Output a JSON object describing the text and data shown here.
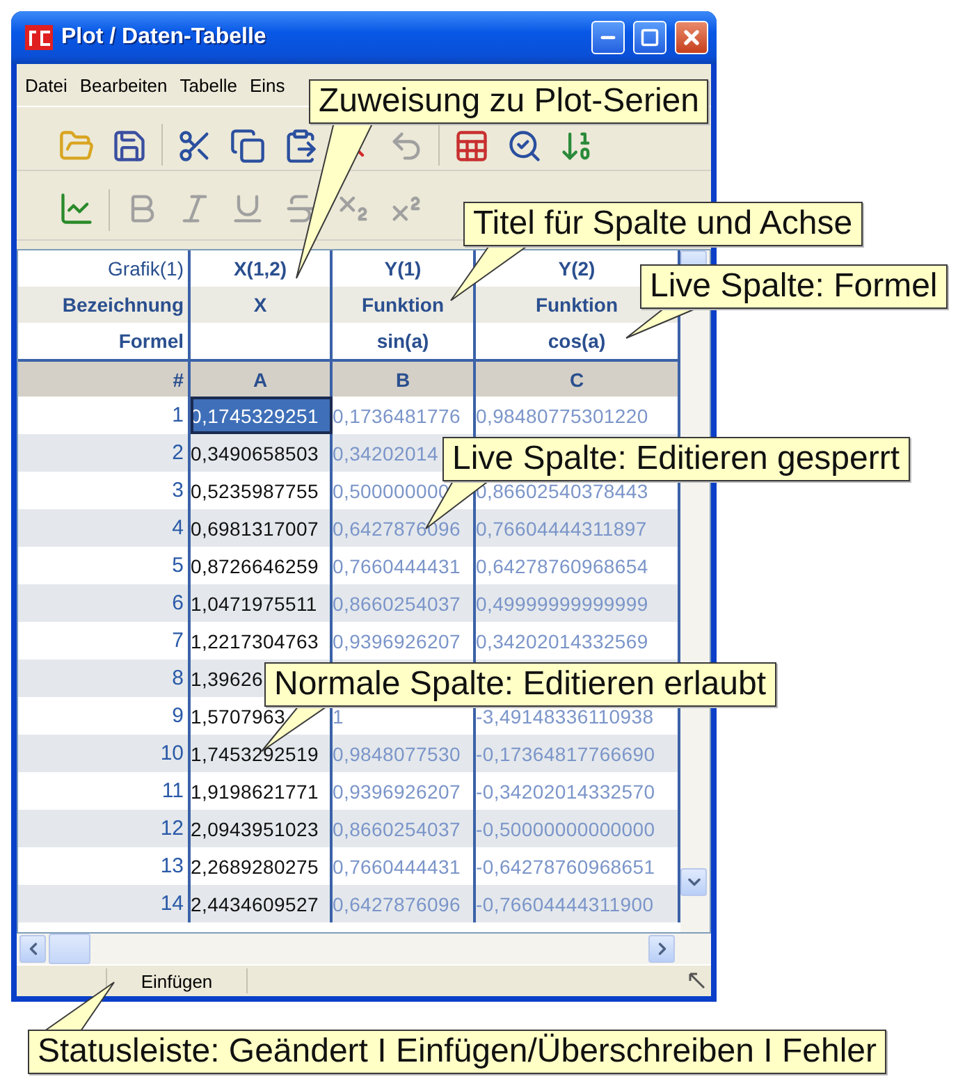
{
  "window": {
    "title": "Plot / Daten-Tabelle"
  },
  "menu": [
    "Datei",
    "Bearbeiten",
    "Tabelle",
    "Eins"
  ],
  "toolbar_1": [
    {
      "kind": "open",
      "disabled": false
    },
    {
      "kind": "save",
      "disabled": false
    },
    {
      "kind": "sep"
    },
    {
      "kind": "cut",
      "disabled": false
    },
    {
      "kind": "copy",
      "disabled": false
    },
    {
      "kind": "paste",
      "disabled": false
    },
    {
      "kind": "delete",
      "disabled": false
    },
    {
      "kind": "undo",
      "disabled": true
    },
    {
      "kind": "sep"
    },
    {
      "kind": "clear",
      "disabled": false
    },
    {
      "kind": "find",
      "disabled": false
    },
    {
      "kind": "sort",
      "disabled": false
    }
  ],
  "toolbar_2": [
    {
      "kind": "add-chart",
      "disabled": false
    },
    {
      "kind": "sep"
    },
    {
      "kind": "bold",
      "disabled": true
    },
    {
      "kind": "italic",
      "disabled": true
    },
    {
      "kind": "underline",
      "disabled": true
    },
    {
      "kind": "strike",
      "disabled": true
    },
    {
      "kind": "subscript",
      "disabled": true
    },
    {
      "kind": "superscript",
      "disabled": true
    }
  ],
  "row_labels": {
    "grafik": "Grafik(1)",
    "bezeichnung": "Bezeichnung",
    "formel": "Formel",
    "number": "#"
  },
  "columns": [
    {
      "letter": "A",
      "grafik": "X(1,2)",
      "bezeichnung": "X",
      "kind": "normal"
    },
    {
      "letter": "B",
      "grafik": "Y(1)",
      "bezeichnung": "Funktion",
      "formel": "sin(a)",
      "kind": "live"
    },
    {
      "letter": "C",
      "grafik": "Y(2)",
      "bezeichnung": "Funktion",
      "formel": "cos(a)",
      "kind": "live"
    }
  ],
  "rows": [
    {
      "number": "1",
      "cells": [
        {
          "text": "0,1745329251",
          "selected": true
        },
        {
          "text": "0,1736481776",
          "selected": false
        },
        {
          "text": "0,98480775301220",
          "selected": false
        }
      ]
    },
    {
      "number": "2",
      "cells": [
        {
          "text": "0,3490658503",
          "selected": false
        },
        {
          "text": "0,34202014",
          "selected": false
        },
        null
      ]
    },
    {
      "number": "3",
      "cells": [
        {
          "text": "0,5235987755",
          "selected": false
        },
        {
          "text": "0,500000000",
          "selected": false
        },
        {
          "text": "0,86602540378443",
          "selected": false
        }
      ]
    },
    {
      "number": "4",
      "cells": [
        {
          "text": "0,6981317007",
          "selected": false
        },
        {
          "text": "0,6427876096",
          "selected": false
        },
        {
          "text": "0,76604444311897",
          "selected": false
        }
      ]
    },
    {
      "number": "5",
      "cells": [
        {
          "text": "0,8726646259",
          "selected": false
        },
        {
          "text": "0,7660444431",
          "selected": false
        },
        {
          "text": "0,64278760968654",
          "selected": false
        }
      ]
    },
    {
      "number": "6",
      "cells": [
        {
          "text": "1,0471975511",
          "selected": false
        },
        {
          "text": "0,8660254037",
          "selected": false
        },
        {
          "text": "0,49999999999999",
          "selected": false
        }
      ]
    },
    {
      "number": "7",
      "cells": [
        {
          "text": "1,2217304763",
          "selected": false
        },
        {
          "text": "0,9396926207",
          "selected": false
        },
        {
          "text": "0,34202014332569",
          "selected": false
        }
      ]
    },
    {
      "number": "8",
      "cells": [
        {
          "text": "1,39626",
          "selected": false
        },
        null,
        null
      ]
    },
    {
      "number": "9",
      "cells": [
        {
          "text": "1,5707963",
          "selected": false
        },
        {
          "text": "1",
          "selected": false
        },
        {
          "text": "-3,49148336110938",
          "selected": false
        }
      ]
    },
    {
      "number": "10",
      "cells": [
        {
          "text": "1,7453292519",
          "selected": false
        },
        {
          "text": "0,9848077530",
          "selected": false
        },
        {
          "text": "-0,17364817766690",
          "selected": false
        }
      ]
    },
    {
      "number": "11",
      "cells": [
        {
          "text": "1,9198621771",
          "selected": false
        },
        {
          "text": "0,9396926207",
          "selected": false
        },
        {
          "text": "-0,34202014332570",
          "selected": false
        }
      ]
    },
    {
      "number": "12",
      "cells": [
        {
          "text": "2,0943951023",
          "selected": false
        },
        {
          "text": "0,8660254037",
          "selected": false
        },
        {
          "text": "-0,50000000000000",
          "selected": false
        }
      ]
    },
    {
      "number": "13",
      "cells": [
        {
          "text": "2,2689280275",
          "selected": false
        },
        {
          "text": "0,7660444431",
          "selected": false
        },
        {
          "text": "-0,64278760968651",
          "selected": false
        }
      ]
    },
    {
      "number": "14",
      "cells": [
        {
          "text": "2,4434609527",
          "selected": false
        },
        {
          "text": "0,6427876096",
          "selected": false
        },
        {
          "text": "-0,76604444311900",
          "selected": false
        }
      ]
    }
  ],
  "status_bar": {
    "mode": "Einfügen"
  },
  "callouts": [
    {
      "text": "Zuweisung zu Plot-Serien"
    },
    {
      "text": "Titel für Spalte und Achse"
    },
    {
      "text": "Live Spalte: Formel"
    },
    {
      "text": "Live Spalte: Editieren gesperrt"
    },
    {
      "text": "Normale Spalte: Editieren erlaubt"
    },
    {
      "text": "Statusleiste: Geändert I Einfügen/Überschreiben I Fehler"
    }
  ]
}
